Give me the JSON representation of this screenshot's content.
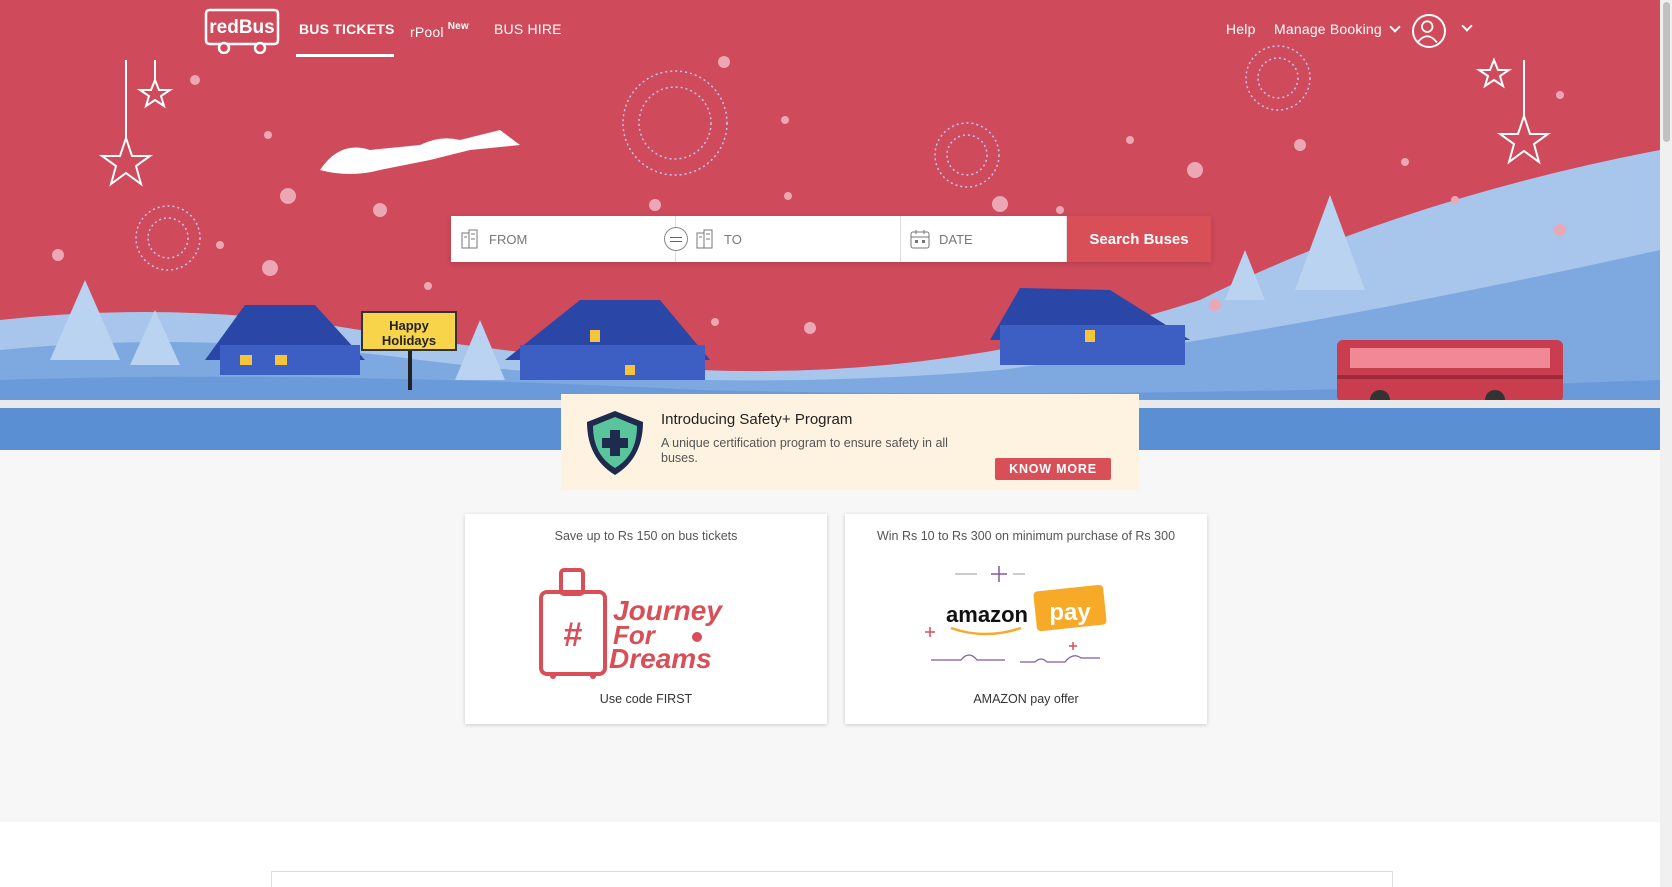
{
  "nav": {
    "logo_text": "redBus",
    "bus_tickets": "BUS TICKETS",
    "rpool": "rPool",
    "rpool_badge": "New",
    "bus_hire": "BUS HIRE",
    "help": "Help",
    "manage_booking": "Manage Booking"
  },
  "hero": {
    "sign_line1": "Happy",
    "sign_line2": "Holidays"
  },
  "search": {
    "from_placeholder": "FROM",
    "to_placeholder": "TO",
    "date_placeholder": "DATE",
    "button_label": "Search Buses"
  },
  "safety": {
    "title": "Introducing Safety+ Program",
    "description": "A unique certification program to ensure safety in all buses.",
    "button_label": "KNOW MORE"
  },
  "offers": [
    {
      "headline": "Save up to Rs 150 on bus tickets",
      "art_line1": "Journey",
      "art_line2": "For",
      "art_line3": "Dreams",
      "caption": "Use code FIRST"
    },
    {
      "headline": "Win Rs 10 to Rs 300 on minimum purchase of Rs 300",
      "art_brand": "amazon",
      "art_pay": "pay",
      "caption": "AMAZON pay offer"
    }
  ],
  "colors": {
    "brand_red": "#d84f57",
    "hero_bg": "#cf4a5a",
    "safety_bg": "#fdf3e0",
    "snow_blue": "#5a8fd4"
  }
}
